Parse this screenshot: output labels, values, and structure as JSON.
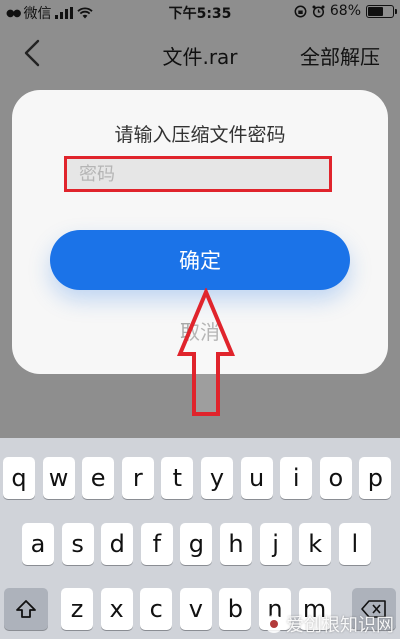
{
  "status_bar": {
    "carrier": "微信",
    "time": "下午5:35",
    "battery_percent": "68%",
    "battery_level": 0.68
  },
  "nav": {
    "title": "文件.rar",
    "right_action": "全部解压"
  },
  "dialog": {
    "title": "请输入压缩文件密码",
    "password_placeholder": "密码",
    "password_value": "",
    "confirm_label": "确定",
    "cancel_label": "取消",
    "annotation_color": "#e0242c"
  },
  "keyboard": {
    "row1": [
      "q",
      "w",
      "e",
      "r",
      "t",
      "y",
      "u",
      "i",
      "o",
      "p"
    ],
    "row2": [
      "a",
      "s",
      "d",
      "f",
      "g",
      "h",
      "j",
      "k",
      "l"
    ],
    "row3": [
      "z",
      "x",
      "c",
      "v",
      "b",
      "n",
      "m"
    ]
  },
  "watermark": {
    "text": "爱创根知识网"
  },
  "colors": {
    "accent": "#1b73e8",
    "overlay": "#8e8e8e",
    "keyboard_bg": "#d0d3d9"
  }
}
